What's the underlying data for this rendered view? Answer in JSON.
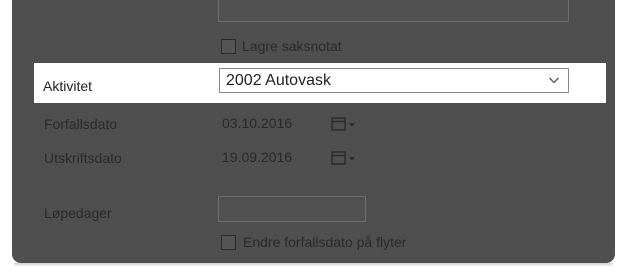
{
  "form": {
    "save_note_checkbox": {
      "label": "Lagre saksnotat",
      "checked": false
    },
    "activity": {
      "label": "Aktivitet",
      "selected": "2002 Autovask"
    },
    "due_date": {
      "label": "Forfallsdato",
      "value": "03.10.2016"
    },
    "print_date": {
      "label": "Utskriftsdato",
      "value": "19.09.2016"
    },
    "running_days": {
      "label": "Løpedager",
      "value": ""
    },
    "change_due_checkbox": {
      "label": "Endre forfallsdato på flyter",
      "checked": false
    }
  },
  "colors": {
    "dim_background": "#4f4f4f",
    "highlight_background": "#ffffff",
    "text_dark": "#222222"
  },
  "icons": [
    "chevron-down-icon",
    "calendar-icon",
    "dropdown-arrow-icon"
  ]
}
